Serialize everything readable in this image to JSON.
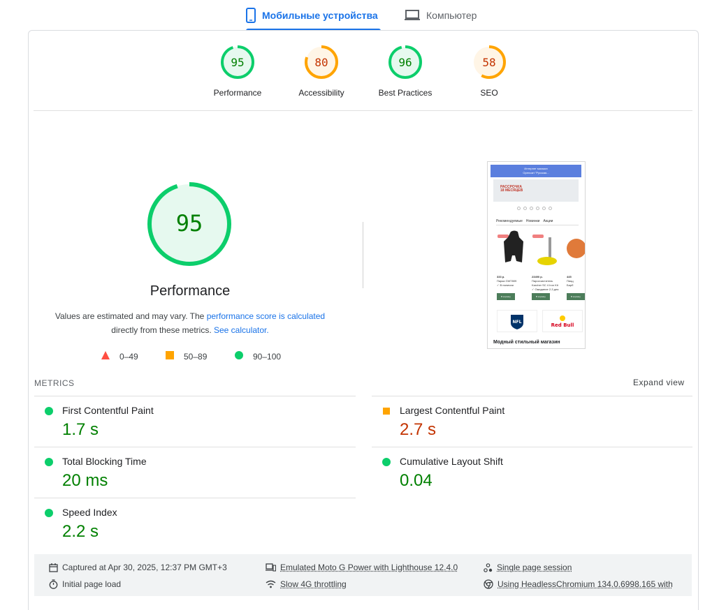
{
  "tabs": {
    "mobile_label": "Мобильные устройства",
    "desktop_label": "Компьютер"
  },
  "categories": [
    {
      "score": "95",
      "label": "Performance",
      "value": 0.95,
      "status": "good"
    },
    {
      "score": "80",
      "label": "Accessibility",
      "value": 0.8,
      "status": "average"
    },
    {
      "score": "96",
      "label": "Best Practices",
      "value": 0.96,
      "status": "good"
    },
    {
      "score": "58",
      "label": "SEO",
      "value": 0.58,
      "status": "average"
    }
  ],
  "performance": {
    "score": "95",
    "value": 0.95,
    "title": "Performance",
    "desc_1": "Values are estimated and may vary. The",
    "desc_link1": "performance score is calculated",
    "desc_2": "directly from these metrics.",
    "desc_link2": "See calculator."
  },
  "legend": {
    "poor": "0–49",
    "average": "50–89",
    "good": "90–100"
  },
  "colors": {
    "good": "#0cce6b",
    "good_text": "#008000",
    "average": "#ffa400",
    "average_text": "#c33300",
    "poor": "#ff4e42",
    "accent": "#1a73e8"
  },
  "thumbnail": {
    "header_line1": "Интернет магазин",
    "header_line2": "Opencart \"Русская...",
    "banner_line1": "РАССРОЧКА",
    "banner_line2": "18 МЕСЯЦЕВ",
    "tab1": "Рекомендуемые",
    "tab2": "Новинки",
    "tab3": "Акции",
    "p1_price": "333 р.",
    "p1_name": "Парка GW7809",
    "p1_stock": "✓ В наличии",
    "p2_price": "23490 р.",
    "p2_name": "Пароочиститель",
    "p2_name2": "Karcher SC 4 Iron Kit",
    "p2_stock": "✓ Ожидание 2-3 дня",
    "p3_price": "445",
    "p3_name": "Пицц",
    "p3_name2": "Барб",
    "cart_label": "В корзину",
    "brand1": "NFL",
    "brand2": "Red Bull",
    "footer": "Модный стильный магазин"
  },
  "metrics": {
    "section_label": "METRICS",
    "expand_label": "Expand view",
    "items": [
      {
        "name": "First Contentful Paint",
        "value": "1.7 s",
        "status": "good"
      },
      {
        "name": "Largest Contentful Paint",
        "value": "2.7 s",
        "status": "average"
      },
      {
        "name": "Total Blocking Time",
        "value": "20 ms",
        "status": "good"
      },
      {
        "name": "Cumulative Layout Shift",
        "value": "0.04",
        "status": "good"
      },
      {
        "name": "Speed Index",
        "value": "2.2 s",
        "status": "good"
      }
    ]
  },
  "env": {
    "captured": "Captured at Apr 30, 2025, 12:37 PM GMT+3",
    "initial": "Initial page load",
    "device": "Emulated Moto G Power with Lighthouse 12.4.0",
    "throttling": "Slow 4G throttling",
    "session": "Single page session",
    "browser": "Using HeadlessChromium 134.0.6998.165 with"
  }
}
